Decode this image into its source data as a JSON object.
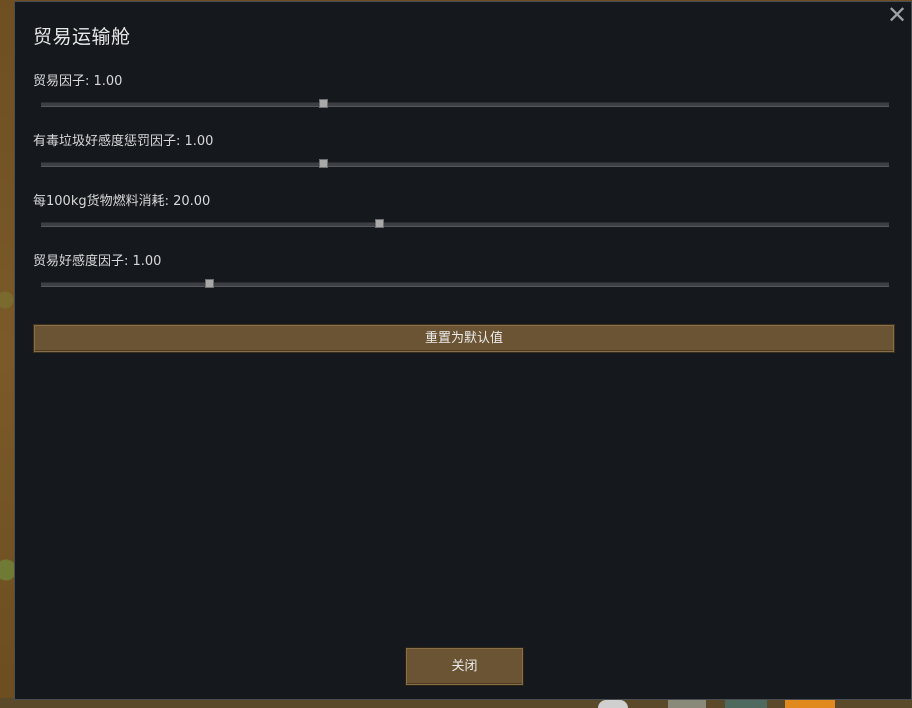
{
  "dialog": {
    "title": "贸易运输舱",
    "close_icon": "close-icon",
    "settings": [
      {
        "label": "贸易因子: 1.00",
        "value": 1.0,
        "position": 0.332
      },
      {
        "label": "有毒垃圾好感度惩罚因子: 1.00",
        "value": 1.0,
        "position": 0.332
      },
      {
        "label": "每100kg货物燃料消耗: 20.00",
        "value": 20.0,
        "position": 0.399
      },
      {
        "label": "贸易好感度因子: 1.00",
        "value": 1.0,
        "position": 0.198
      }
    ],
    "reset_label": "重置为默认值",
    "close_label": "关闭"
  },
  "colors": {
    "panel_bg": "#15181d",
    "button_bg": "#6b5434",
    "text": "#d9d9d9"
  }
}
